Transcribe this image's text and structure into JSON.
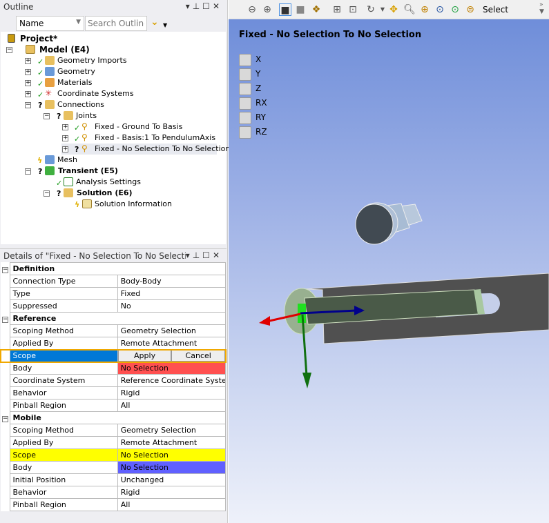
{
  "outline": {
    "title": "Outline",
    "filter_value": "Name",
    "search_placeholder": "Search Outline",
    "items": [
      "Project*",
      "Model (E4)",
      "Geometry Imports",
      "Geometry",
      "Materials",
      "Coordinate Systems",
      "Connections",
      "Joints",
      "Fixed - Ground To Basis",
      "Fixed - Basis:1 To PendulumAxis",
      "Fixed - No Selection To No Selection",
      "Mesh",
      "Transient (E5)",
      "Analysis Settings",
      "Solution (E6)",
      "Solution Information"
    ]
  },
  "details": {
    "title": "Details of \"Fixed - No Selection To No Selection\"",
    "groups": [
      {
        "name": "Definition",
        "rows": [
          [
            "Connection Type",
            "Body-Body"
          ],
          [
            "Type",
            "Fixed"
          ],
          [
            "Suppressed",
            "No"
          ]
        ]
      },
      {
        "name": "Reference",
        "rows": [
          [
            "Scoping Method",
            "Geometry Selection"
          ],
          [
            "Applied By",
            "Remote Attachment"
          ],
          [
            "Scope",
            "Apply",
            "Cancel"
          ],
          [
            "Body",
            "No Selection"
          ],
          [
            "Coordinate System",
            "Reference Coordinate System"
          ],
          [
            "Behavior",
            "Rigid"
          ],
          [
            "Pinball Region",
            "All"
          ]
        ]
      },
      {
        "name": "Mobile",
        "rows": [
          [
            "Scoping Method",
            "Geometry Selection"
          ],
          [
            "Applied By",
            "Remote Attachment"
          ],
          [
            "Scope",
            "No Selection"
          ],
          [
            "Body",
            "No Selection"
          ],
          [
            "Initial Position",
            "Unchanged"
          ],
          [
            "Behavior",
            "Rigid"
          ],
          [
            "Pinball Region",
            "All"
          ]
        ]
      }
    ]
  },
  "toolbar": {
    "select_label": "Select"
  },
  "viewport": {
    "title": "Fixed - No Selection To No Selection",
    "dofs": [
      "X",
      "Y",
      "Z",
      "RX",
      "RY",
      "RZ"
    ]
  },
  "colors": {
    "accent": "#0078d7",
    "error": "#ff5050",
    "scope_yellow": "#ffff00",
    "body_blue": "#6060ff",
    "highlight_border": "#f0a800"
  }
}
